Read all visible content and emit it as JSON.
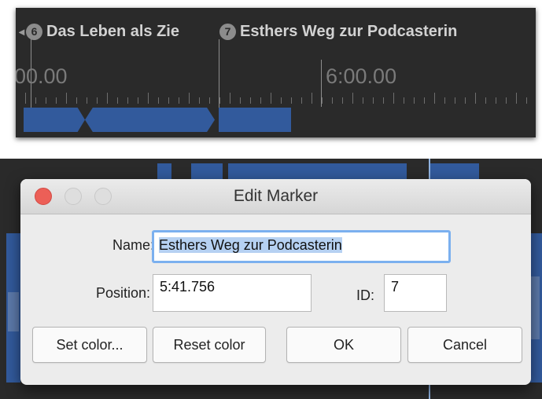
{
  "timeline": {
    "markers": [
      {
        "number": "6",
        "label": "Das Leben als Zie"
      },
      {
        "number": "7",
        "label": "Esthers Weg zur Podcasterin"
      }
    ],
    "time_labels": [
      "00.00",
      "6:00.00"
    ]
  },
  "dialog": {
    "title": "Edit Marker",
    "name_label": "Name:",
    "name_value": "Esthers Weg zur Podcasterin",
    "position_label": "Position:",
    "position_value": "5:41.756",
    "id_label": "ID:",
    "id_value": "7",
    "buttons": {
      "set_color": "Set color...",
      "reset_color": "Reset color",
      "ok": "OK",
      "cancel": "Cancel"
    }
  },
  "colors": {
    "track_blue": "#325a9c",
    "panel_dark": "#2a2a2a",
    "close_red": "#ec5f57",
    "selection_blue": "#b6d1f2",
    "focus_ring": "#7bb0ef"
  }
}
